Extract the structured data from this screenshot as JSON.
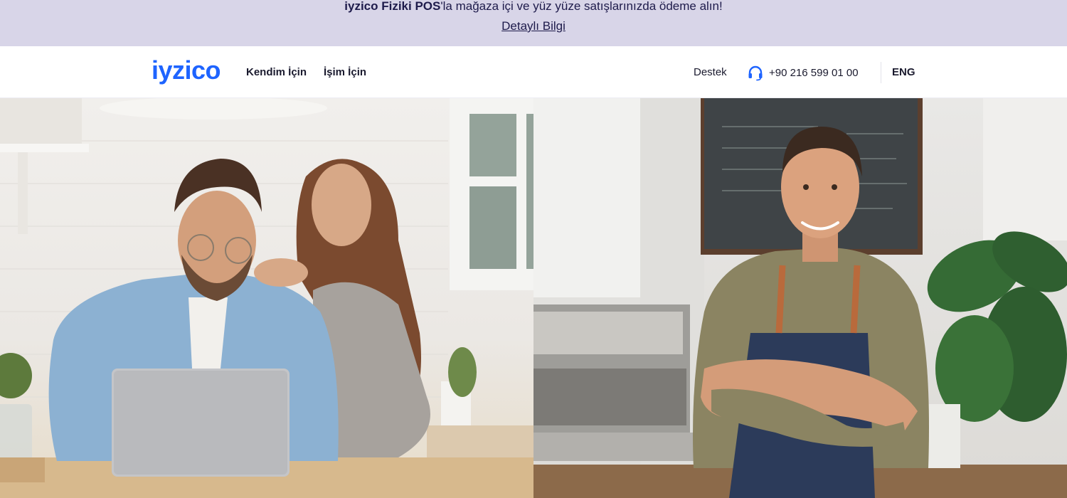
{
  "announcement": {
    "brand": "iyzico Fiziki POS",
    "text": "'la mağaza içi ve yüz yüze satışlarınızda ödeme alın!",
    "link": "Detaylı Bilgi"
  },
  "header": {
    "logo": "iyzico",
    "nav": [
      "Kendim İçin",
      "İşim İçin"
    ],
    "support": "Destek",
    "phone": "+90 216 599 01 00",
    "language": "ENG"
  },
  "colors": {
    "announcement_bg": "#d8d5e8",
    "brand_blue": "#1e64ff",
    "text_dark": "#1a1a2e"
  },
  "icons": {
    "phone": "headset-icon"
  }
}
